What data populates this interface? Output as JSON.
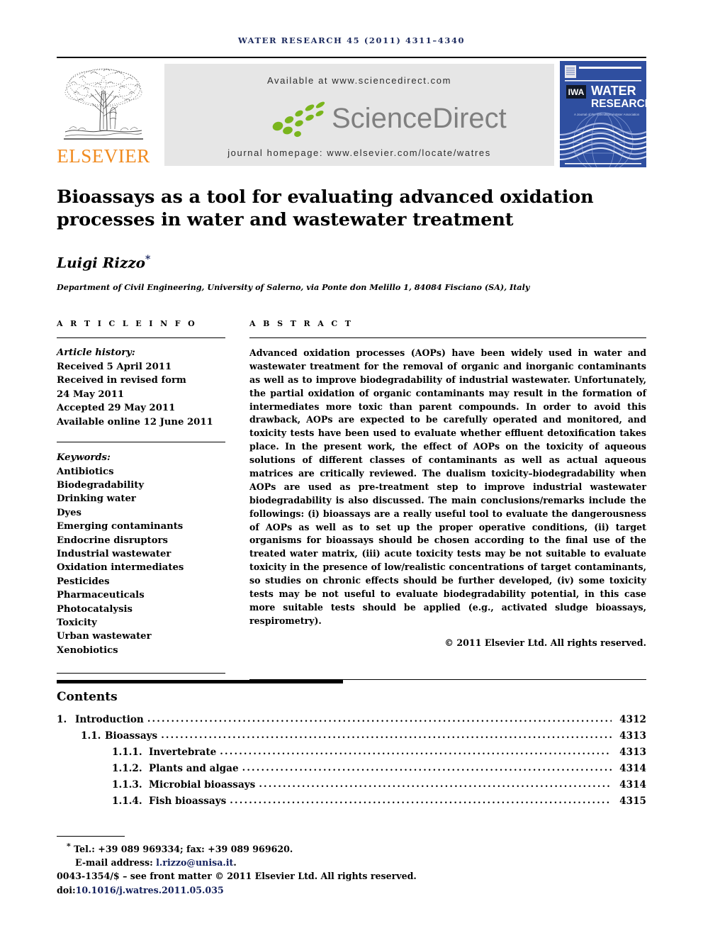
{
  "running_head": "WATER RESEARCH 45 (2011) 4311–4340",
  "masthead": {
    "publisher_name": "ELSEVIER",
    "available_at": "Available at www.sciencedirect.com",
    "journal_homepage": "journal homepage: www.elsevier.com/locate/watres",
    "sciencedirect_wordmark": "ScienceDirect",
    "cover": {
      "line1": "WATER",
      "line2": "RESEARCH",
      "association_mark": "IWA",
      "tagline": "A Journal of the International Water Association"
    }
  },
  "article": {
    "title": "Bioassays as a tool for evaluating advanced oxidation processes in water and wastewater treatment",
    "author": "Luigi Rizzo",
    "author_footnote_marker": "*",
    "affiliation": "Department of Civil Engineering, University of Salerno, via Ponte don Melillo 1, 84084 Fisciano (SA), Italy"
  },
  "article_info": {
    "heading": "A R T I C L E  I N F O",
    "history_label": "Article history:",
    "history": [
      "Received 5 April 2011",
      "Received in revised form",
      "24 May 2011",
      "Accepted 29 May 2011",
      "Available online 12 June 2011"
    ],
    "keywords_label": "Keywords:",
    "keywords": [
      "Antibiotics",
      "Biodegradability",
      "Drinking water",
      "Dyes",
      "Emerging contaminants",
      "Endocrine disruptors",
      "Industrial wastewater",
      "Oxidation intermediates",
      "Pesticides",
      "Pharmaceuticals",
      "Photocatalysis",
      "Toxicity",
      "Urban wastewater",
      "Xenobiotics"
    ]
  },
  "abstract": {
    "heading": "A B S T R A C T",
    "text": "Advanced oxidation processes (AOPs) have been widely used in water and wastewater treatment for the removal of organic and inorganic contaminants as well as to improve biodegradability of industrial wastewater. Unfortunately, the partial oxidation of organic contaminants may result in the formation of intermediates more toxic than parent compounds. In order to avoid this drawback, AOPs are expected to be carefully operated and monitored, and toxicity tests have been used to evaluate whether effluent detoxification takes place. In the present work, the effect of AOPs on the toxicity of aqueous solutions of different classes of contaminants as well as actual aqueous matrices are critically reviewed. The dualism toxicity–biodegradability when AOPs are used as pre-treatment step to improve industrial wastewater biodegradability is also discussed. The main conclusions/remarks include the followings: (i) bioassays are a really useful tool to evaluate the dangerousness of AOPs as well as to set up the proper operative conditions, (ii) target organisms for bioassays should be chosen according to the final use of the treated water matrix, (iii) acute toxicity tests may be not suitable to evaluate toxicity in the presence of low/realistic concentrations of target contaminants, so studies on chronic effects should be further developed, (iv) some toxicity tests may be not useful to evaluate biodegradability potential, in this case more suitable tests should be applied (e.g., activated sludge bioassays, respirometry).",
    "copyright": "© 2011 Elsevier Ltd. All rights reserved."
  },
  "contents": {
    "heading": "Contents",
    "entries": [
      {
        "level": 1,
        "number": "1.",
        "label": "Introduction",
        "page": "4312"
      },
      {
        "level": 2,
        "number": "1.1.",
        "label": "Bioassays",
        "page": "4313"
      },
      {
        "level": 3,
        "number": "1.1.1.",
        "label": "Invertebrate",
        "page": "4313"
      },
      {
        "level": 3,
        "number": "1.1.2.",
        "label": "Plants and algae",
        "page": "4314"
      },
      {
        "level": 3,
        "number": "1.1.3.",
        "label": "Microbial bioassays",
        "page": "4314"
      },
      {
        "level": 3,
        "number": "1.1.4.",
        "label": "Fish bioassays",
        "page": "4315"
      }
    ]
  },
  "footnote": {
    "marker": "*",
    "tel_fax": "Tel.: +39 089 969334; fax: +39 089 969620.",
    "email_label": "E-mail address:",
    "email": "l.rizzo@unisa.it",
    "email_trailing": ".",
    "front_matter": "0043-1354/$ – see front matter © 2011 Elsevier Ltd. All rights reserved.",
    "doi_label": "doi:",
    "doi": "10.1016/j.watres.2011.05.035"
  },
  "colors": {
    "elsevier_orange": "#f08a1e",
    "link_blue": "#13205c",
    "banner_gray": "#e6e6e6",
    "cover_blue": "#2a4a9a",
    "sciencedirect_green": "#7ab51d",
    "sciencedirect_gray": "#7f7f7f"
  }
}
